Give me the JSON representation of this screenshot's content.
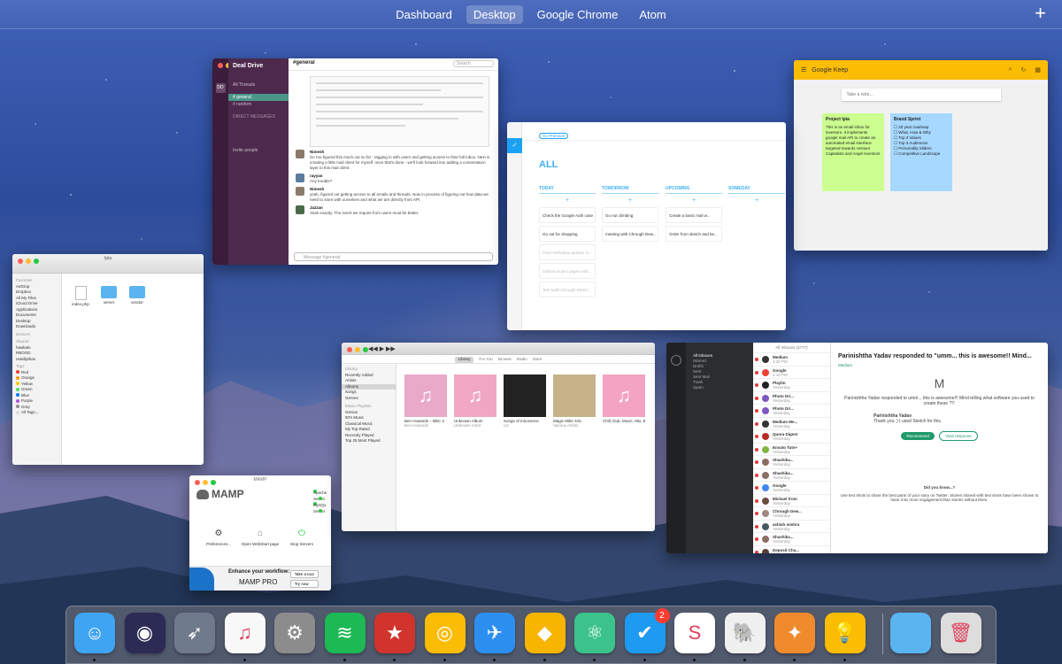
{
  "spaces": {
    "tabs": [
      {
        "label": "Dashboard"
      },
      {
        "label": "Desktop"
      },
      {
        "label": "Google Chrome"
      },
      {
        "label": "Atom"
      }
    ],
    "active": "Desktop",
    "add_label": "+"
  },
  "slack": {
    "team": "Deal Drive",
    "channel": "#general",
    "all_threads": "All Threads",
    "channels": [
      "# general",
      "# random"
    ],
    "direct_header": "DIRECT MESSAGES",
    "search_placeholder": "Search",
    "messages": [
      {
        "author": "Nimesh",
        "text": "So I've figured this much out so far - tagging in with users and getting access to their full inbox. Next is creating a little mail client for myself, once that's done - we'll look forward into adding a conversation layer to this mail client."
      },
      {
        "author": "rayyan",
        "text": "Any trouble?"
      },
      {
        "author": "Nimesh",
        "text": "yeah, figured out getting access to all emails and threads. Now in process of figuring out how data we need to store with ourselves and what we are directly from API."
      },
      {
        "author": "Jazzan",
        "text": "Yeah exactly. The invert we require from users must be better."
      }
    ],
    "compose_placeholder": "Message #general",
    "invite": "Invite people"
  },
  "keep": {
    "title": "Google Keep",
    "take_note": "Take a note...",
    "notes": [
      {
        "title": "Project Ipia",
        "body": "This is an email inbox for investors. It implements google mail API to create an automated email interface targeted towards Venture Capitalists and Angel Investors"
      },
      {
        "title": "Brand Sprint",
        "items": [
          "20 year roadmap",
          "What, How & Why",
          "Top 3 Values",
          "Top 3 Audiences",
          "Personality Sliders",
          "Competitive Landscape"
        ]
      }
    ]
  },
  "tasks": {
    "pill": "Go Premium",
    "heading": "ALL",
    "columns": [
      {
        "caption": "TODAY",
        "cards": [
          "Check the Google Auth case",
          "Go out for shopping",
          "Post marketing updates in...",
          "Submit project pages with...",
          "Test build Chrough Ekstrn..."
        ]
      },
      {
        "caption": "TOMORROW",
        "cards": [
          "Go nut climbing",
          "meeting with Chrough Dew..."
        ]
      },
      {
        "caption": "UPCOMING",
        "cards": [
          "Create a basic mail w...",
          "Order from sketch and be..."
        ]
      },
      {
        "caption": "SOMEDAY",
        "cards": []
      }
    ]
  },
  "finder": {
    "title": "Ipia",
    "favorites_header": "Favorites",
    "favorites": [
      "AirDrop",
      "Dropbox",
      "All My Files",
      "iCloud Drive",
      "Applications",
      "Documents",
      "Desktop",
      "Downloads"
    ],
    "devices_header": "Devices",
    "shared_header": "Shared",
    "shared": [
      "hawkalo",
      "RBOOD",
      "realdipthas"
    ],
    "tags_header": "Tags",
    "tags": [
      {
        "name": "Red",
        "color": "#ff3b30"
      },
      {
        "name": "Orange",
        "color": "#ff9500"
      },
      {
        "name": "Yellow",
        "color": "#ffcc00"
      },
      {
        "name": "Green",
        "color": "#4cd964"
      },
      {
        "name": "Blue",
        "color": "#007aff"
      },
      {
        "name": "Purple",
        "color": "#af52de"
      },
      {
        "name": "Gray",
        "color": "#8e8e93"
      },
      {
        "name": "All Tags...",
        "color": "#dddddd"
      }
    ],
    "files": [
      {
        "name": "index.php",
        "kind": "doc"
      },
      {
        "name": "server",
        "kind": "folder"
      },
      {
        "name": "vendor",
        "kind": "folder"
      }
    ]
  },
  "mamp": {
    "title": "MAMP",
    "logo": "MAMP",
    "servers": [
      "Apache Server",
      "MySQL Server"
    ],
    "actions": [
      {
        "icon": "⚙",
        "label": "Preferences..."
      },
      {
        "icon": "⌂",
        "label": "Open WebStart page"
      },
      {
        "icon": "⏻",
        "label": "Stop Servers"
      }
    ],
    "promo_title": "Enhance your workflow:",
    "promo_product": "MAMP PRO",
    "promo_buttons": [
      "Take a tour",
      "Try now"
    ]
  },
  "itunes": {
    "nav": [
      "Library",
      "For You",
      "Browse",
      "Radio",
      "Store"
    ],
    "nav_active": "Library",
    "library_header": "Library",
    "library": [
      "Recently Added",
      "Artists",
      "Albums",
      "Songs",
      "Genres"
    ],
    "library_selected": "Albums",
    "playlists_header": "Music Playlists",
    "playlists": [
      "Genius",
      "90's Music",
      "Classical Music",
      "My Top Rated",
      "Recently Played",
      "Top 25 Most Played"
    ],
    "albums": [
      {
        "title": "Ben Howards – BBC 2",
        "artist": "Ben Howards",
        "color": "#e9a9c9"
      },
      {
        "title": "Unknown Album",
        "artist": "Unknown Artist",
        "color": "#f0a7c4"
      },
      {
        "title": "Songs of Innocence",
        "artist": "U2",
        "color": "#222222"
      },
      {
        "title": "Magic Mike XXL",
        "artist": "Various Artists",
        "color": "#c6b38a"
      },
      {
        "title": "Chill, Dub, Music, Mix, Bes...",
        "artist": "",
        "color": "#f4a3c2"
      }
    ]
  },
  "mail": {
    "folders": [
      "All Inboxes",
      "Starred",
      "Drafts",
      "Sent",
      "Sent Mail",
      "Trash",
      "Spam"
    ],
    "list_header": "All Inboxes (2777)",
    "rows": [
      {
        "from": "Medium",
        "time": "4:32 PM",
        "color": "#333333"
      },
      {
        "from": "Google",
        "time": "4:15 PM",
        "color": "#ea4335"
      },
      {
        "from": "Playlin",
        "time": "Yesterday",
        "color": "#222222"
      },
      {
        "from": "Photo Dri...",
        "time": "Yesterday",
        "color": "#7e57c2"
      },
      {
        "from": "Photo Dri...",
        "time": "Yesterday",
        "color": "#7e57c2"
      },
      {
        "from": "Medium Me...",
        "time": "Yesterday",
        "color": "#333333"
      },
      {
        "from": "Quora Digest",
        "time": "Yesterday",
        "color": "#b92b27"
      },
      {
        "from": "Envato Tuts+",
        "time": "Yesterday",
        "color": "#82b541"
      },
      {
        "from": "Shashika...",
        "time": "Yesterday",
        "color": "#8d6e63"
      },
      {
        "from": "Shashika...",
        "time": "Yesterday",
        "color": "#8d6e63"
      },
      {
        "from": "Google",
        "time": "Yesterday",
        "color": "#4285f4"
      },
      {
        "from": "Michael from",
        "time": "Yesterday",
        "color": "#6d4c41"
      },
      {
        "from": "Chrough Dew...",
        "time": "Yesterday",
        "color": "#a1887f"
      },
      {
        "from": "ashish mishra",
        "time": "Yesterday",
        "color": "#455a64"
      },
      {
        "from": "Shashika...",
        "time": "Yesterday",
        "color": "#8d6e63"
      },
      {
        "from": "Deposit Cha...",
        "time": "Yesterday",
        "color": "#5d4037"
      },
      {
        "from": "Recruiter for",
        "time": "Yesterday",
        "color": "#424242"
      }
    ],
    "subject": "Parinishtha Yadav responded to \"umm... this is awesome!! Mind...",
    "sender": "Medium",
    "quote": "Parinishtha Yadav responded to umm... this is awesome!!! Mind telling what software you used to create these ??:",
    "responder": "Parinishtha Yadav",
    "reply": "Thank you :) I used Sketch for this.",
    "btn_recommend": "Recommend",
    "btn_view": "View response",
    "did_you_know": "Did you know...?",
    "footer": "Use text shots to share the best parts of your story on Twitter. Stories shared with text shots have been shown to have 3-5x more engagement than stories without them."
  },
  "dock": {
    "apps": [
      {
        "name": "Finder",
        "icon": "☺",
        "bg": "#3fa4f1",
        "running": true
      },
      {
        "name": "Siri",
        "icon": "◉",
        "bg": "#2b2b55",
        "running": false
      },
      {
        "name": "Launchpad",
        "icon": "➶",
        "bg": "#6f7b8c",
        "running": false
      },
      {
        "name": "iTunes",
        "icon": "♫",
        "bg": "#f8f8f8",
        "running": true
      },
      {
        "name": "System Preferences",
        "icon": "⚙",
        "bg": "#8c8c8c",
        "running": false
      },
      {
        "name": "Spotify",
        "icon": "≋",
        "bg": "#1db954",
        "running": true
      },
      {
        "name": "Wunderlist",
        "icon": "★",
        "bg": "#d0342c",
        "running": true
      },
      {
        "name": "Google Chrome",
        "icon": "◎",
        "bg": "#fbbc05",
        "running": true
      },
      {
        "name": "Airmail",
        "icon": "✈",
        "bg": "#2c8ff0",
        "running": true
      },
      {
        "name": "Sketch",
        "icon": "◆",
        "bg": "#f7b500",
        "running": true
      },
      {
        "name": "Atom",
        "icon": "⚛",
        "bg": "#3cc38b",
        "running": true
      },
      {
        "name": "Todoist",
        "icon": "✔",
        "bg": "#1e9bf0",
        "running": true,
        "badge": "2"
      },
      {
        "name": "Slack",
        "icon": "S",
        "bg": "#ffffff",
        "running": true
      },
      {
        "name": "MAMP",
        "icon": "🐘",
        "bg": "#f0f0f0",
        "running": true
      },
      {
        "name": "Transmit",
        "icon": "✦",
        "bg": "#ef8b2c",
        "running": true
      },
      {
        "name": "Google Keep",
        "icon": "💡",
        "bg": "#fbbc04",
        "running": true
      },
      {
        "name": "Folder",
        "icon": "",
        "bg": "#5ab4f0",
        "running": false
      },
      {
        "name": "Trash",
        "icon": "🗑",
        "bg": "#dddddd",
        "running": false
      }
    ]
  }
}
